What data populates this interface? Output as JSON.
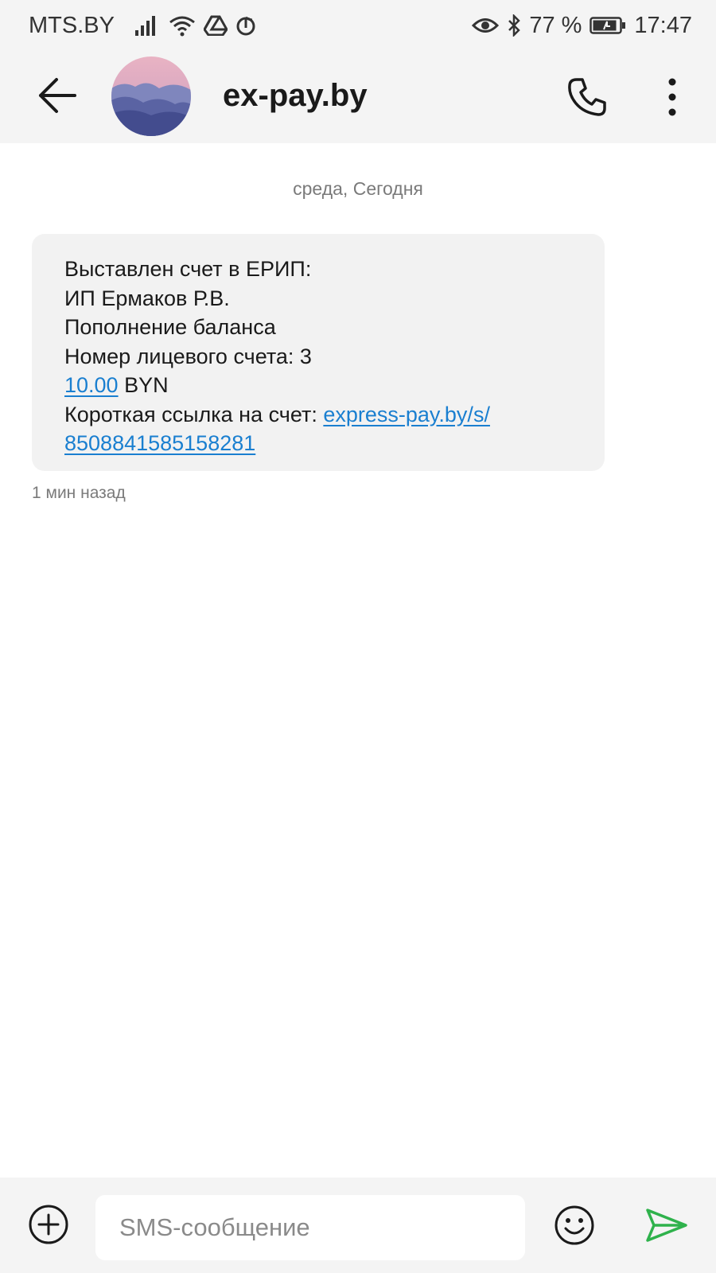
{
  "status_bar": {
    "carrier": "MTS.BY",
    "battery": "77 %",
    "time": "17:47",
    "icons": [
      "signal-icon",
      "wifi-icon",
      "drive-icon",
      "tiktok-icon",
      "eye-icon",
      "bluetooth-icon",
      "battery-icon"
    ]
  },
  "header": {
    "contact_name": "ex-pay.by",
    "icons": [
      "back-arrow-icon",
      "avatar",
      "phone-icon",
      "more-vert-icon"
    ]
  },
  "conversation": {
    "date_separator": "среда, Сегодня",
    "message": {
      "line1": "Выставлен счет в ЕРИП:",
      "line2": "ИП Ермаков Р.В.",
      "line3": "Пополнение баланса",
      "line4": "Номер лицевого счета: 3",
      "amount_value": "10.00",
      "amount_currency": " BYN",
      "link_label": "Короткая ссылка на счет: ",
      "link_part1": "express-pay.by/s/",
      "link_part2": "8508841585158281"
    },
    "time_ago": "1 мин назад"
  },
  "composer": {
    "placeholder": "SMS-сообщение",
    "icons": [
      "add-icon",
      "emoji-icon",
      "send-icon"
    ]
  },
  "colors": {
    "bar_background": "#f4f4f4",
    "bubble_background": "#f2f2f2",
    "link": "#1a7fd0",
    "send": "#2fb24c"
  }
}
